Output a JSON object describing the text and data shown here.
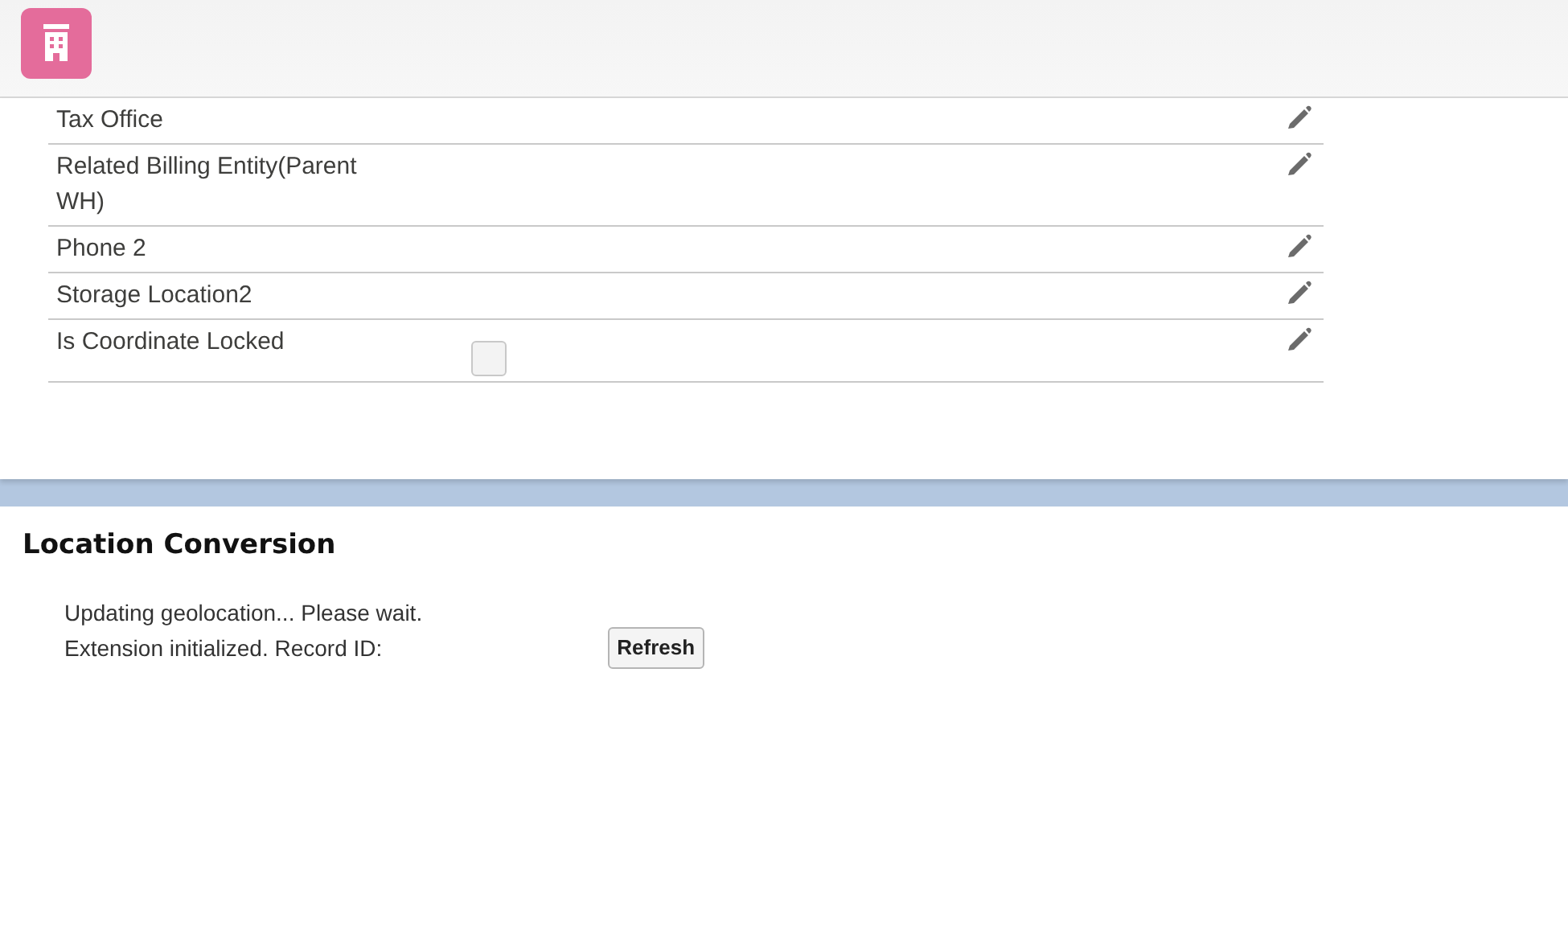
{
  "fields": [
    {
      "label": "Tax Office",
      "kind": "text",
      "editable": true
    },
    {
      "label": "Related Billing Entity(Parent WH)",
      "kind": "text",
      "editable": true
    },
    {
      "label": "Phone 2",
      "kind": "text",
      "editable": true
    },
    {
      "label": "Storage Location2",
      "kind": "text",
      "editable": true
    },
    {
      "label": "Is Coordinate Locked",
      "kind": "checkbox",
      "checked": false,
      "editable": true
    }
  ],
  "extension": {
    "title": "Location Conversion",
    "lines": [
      {
        "text": "Updating geolocation... Please wait."
      },
      {
        "text": "Extension initialized. Record ID:",
        "button": "Refresh"
      }
    ]
  }
}
